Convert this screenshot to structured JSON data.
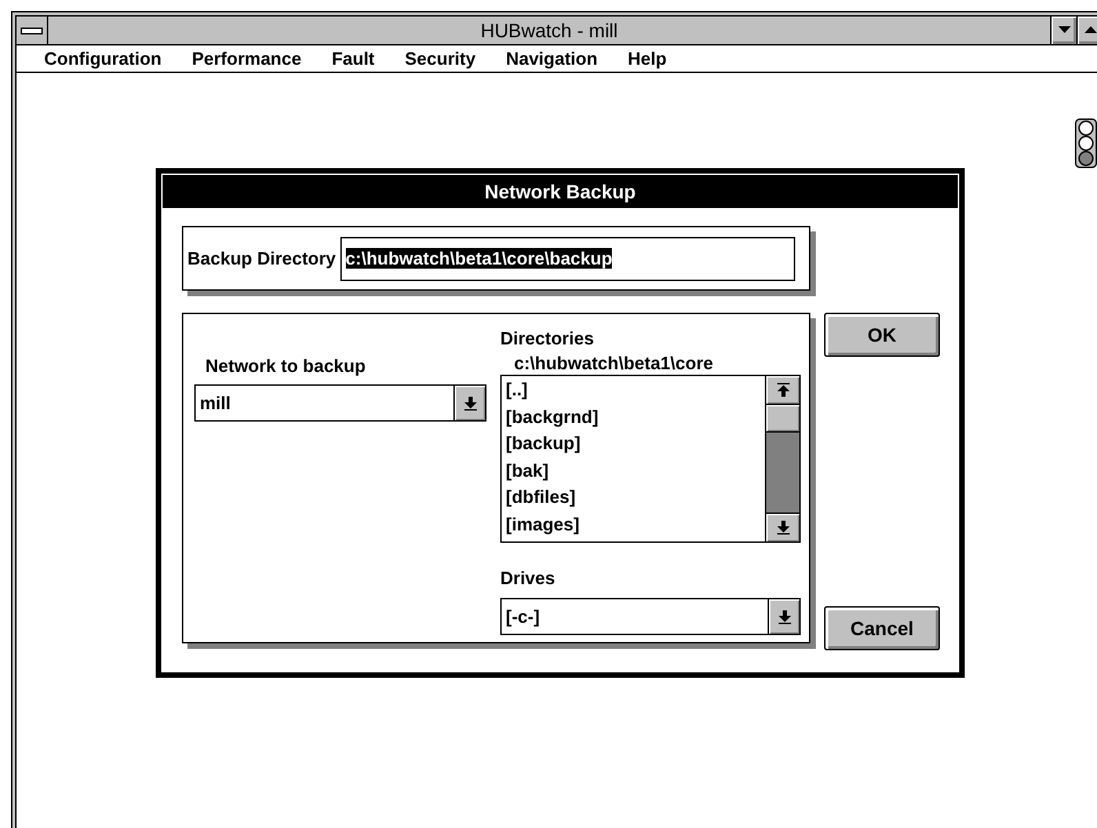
{
  "window": {
    "title": "HUBwatch - mill"
  },
  "menu": [
    {
      "label": "Configuration"
    },
    {
      "label": "Performance"
    },
    {
      "label": "Fault"
    },
    {
      "label": "Security"
    },
    {
      "label": "Navigation"
    },
    {
      "label": "Help"
    }
  ],
  "dialog": {
    "title": "Network Backup",
    "backup_directory": {
      "label": "Backup Directory",
      "value": "c:\\hubwatch\\beta1\\core\\backup",
      "text_selected": true
    },
    "network": {
      "label": "Network to backup",
      "value": "mill"
    },
    "directories": {
      "label": "Directories",
      "path": "c:\\hubwatch\\beta1\\core",
      "items": [
        {
          "label": "[..]",
          "selected": false
        },
        {
          "label": "[backgrnd]",
          "selected": false
        },
        {
          "label": "[backup]",
          "selected": false
        },
        {
          "label": "[bak]",
          "selected": false
        },
        {
          "label": "[dbfiles]",
          "selected": false
        },
        {
          "label": "[images]",
          "selected": false
        }
      ]
    },
    "drives": {
      "label": "Drives",
      "value": "[-c-]"
    },
    "buttons": [
      {
        "label": "OK"
      },
      {
        "label": "Cancel"
      }
    ]
  }
}
